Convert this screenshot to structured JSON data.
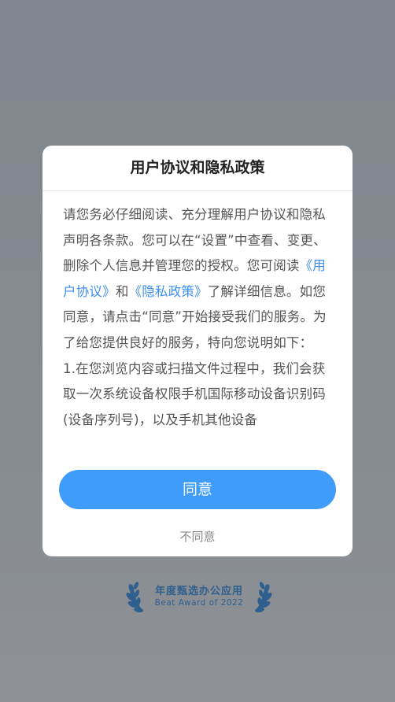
{
  "dialog": {
    "title": "用户协议和隐私政策",
    "body_parts": {
      "p1_before": "请您务必仔细阅读、充分理解用户协议和隐私声明各条款。您可以在“设置”中查看、变更、删除个人信息并管理您的授权。您可阅读",
      "link_user_agreement": "《用户协议》",
      "p1_and": "和",
      "link_privacy_policy": "《隐私政策》",
      "p1_after": "了解详细信息。如您同意，请点击“同意”开始接受我们的服务。为了给您提供良好的服务，特向您说明如下：",
      "p2": "1.在您浏览内容或扫描文件过程中，我们会获取一次系统设备权限手机国际移动设备识别码(设备序列号)，以及手机其他设备"
    },
    "agree_label": "同意",
    "disagree_label": "不同意"
  },
  "award": {
    "title": "年度甄选办公应用",
    "subtitle": "Beat Award of 2022"
  },
  "colors": {
    "overlay_bg": "#858b91",
    "link": "#3d8ff1",
    "agree_button": "#3f9cfb",
    "award_text": "#2f5f8f"
  },
  "icons": {
    "laurel": "laurel-wreath-icon"
  }
}
